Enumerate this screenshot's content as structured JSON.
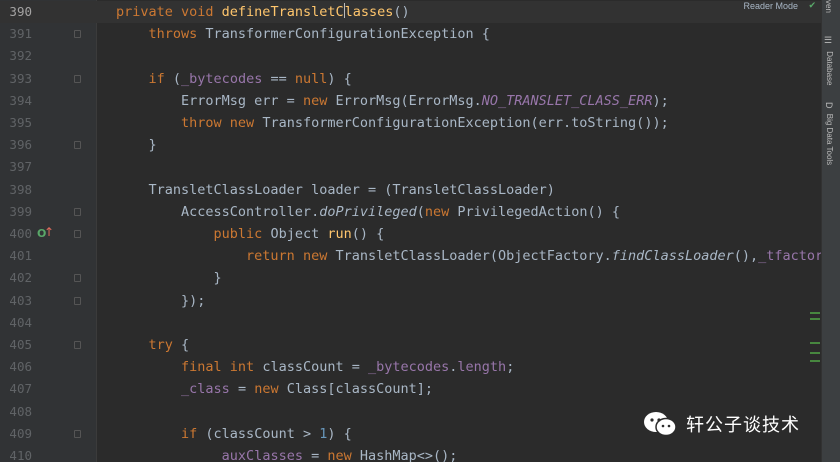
{
  "editor": {
    "reader_mode_label": "Reader Mode",
    "lines": [
      {
        "n": "390",
        "current": true,
        "tokens": [
          [
            "kw",
            "private "
          ],
          [
            "kw",
            "void "
          ],
          [
            "fn",
            "defineTransletC"
          ],
          [
            "caret",
            ""
          ],
          [
            "fn",
            "lasses"
          ],
          [
            "p",
            "()"
          ]
        ]
      },
      {
        "n": "391",
        "fold": true,
        "tokens": [
          [
            "p",
            "    "
          ],
          [
            "kw",
            "throws "
          ],
          [
            "p",
            "TransformerConfigurationException {"
          ]
        ]
      },
      {
        "n": "392",
        "tokens": []
      },
      {
        "n": "393",
        "fold": true,
        "tokens": [
          [
            "p",
            "    "
          ],
          [
            "kw",
            "if "
          ],
          [
            "p",
            "("
          ],
          [
            "fld",
            "_bytecodes"
          ],
          [
            "p",
            " == "
          ],
          [
            "kw",
            "null"
          ],
          [
            "p",
            ") {"
          ]
        ]
      },
      {
        "n": "394",
        "tokens": [
          [
            "p",
            "        ErrorMsg err = "
          ],
          [
            "kw",
            "new "
          ],
          [
            "p",
            "ErrorMsg(ErrorMsg."
          ],
          [
            "sfld",
            "NO_TRANSLET_CLASS_ERR"
          ],
          [
            "p",
            ");"
          ]
        ]
      },
      {
        "n": "395",
        "tokens": [
          [
            "p",
            "        "
          ],
          [
            "kw",
            "throw new "
          ],
          [
            "p",
            "TransformerConfigurationException(err.toString());"
          ]
        ]
      },
      {
        "n": "396",
        "fold": true,
        "tokens": [
          [
            "p",
            "    }"
          ]
        ]
      },
      {
        "n": "397",
        "tokens": []
      },
      {
        "n": "398",
        "tokens": [
          [
            "p",
            "    TransletClassLoader loader = (TransletClassLoader)"
          ]
        ]
      },
      {
        "n": "399",
        "fold": true,
        "tokens": [
          [
            "p",
            "        AccessController."
          ],
          [
            "smeth",
            "doPrivileged"
          ],
          [
            "p",
            "("
          ],
          [
            "kw",
            "new "
          ],
          [
            "p",
            "PrivilegedAction() {"
          ]
        ]
      },
      {
        "n": "400",
        "fold": true,
        "tokens": [
          [
            "p",
            "            "
          ],
          [
            "kw",
            "public "
          ],
          [
            "p",
            "Object "
          ],
          [
            "fn",
            "run"
          ],
          [
            "p",
            "() {"
          ]
        ]
      },
      {
        "n": "401",
        "tokens": [
          [
            "p",
            "                "
          ],
          [
            "kw",
            "return new "
          ],
          [
            "p",
            "TransletClassLoader(ObjectFactory."
          ],
          [
            "smeth",
            "findClassLoader"
          ],
          [
            "p",
            "(),"
          ],
          [
            "fld",
            "_tfactory"
          ],
          [
            "p",
            ".ge"
          ]
        ]
      },
      {
        "n": "402",
        "fold": true,
        "tokens": [
          [
            "p",
            "            }"
          ]
        ]
      },
      {
        "n": "403",
        "fold": true,
        "tokens": [
          [
            "p",
            "        });"
          ]
        ]
      },
      {
        "n": "404",
        "tokens": []
      },
      {
        "n": "405",
        "fold": true,
        "tokens": [
          [
            "p",
            "    "
          ],
          [
            "kw",
            "try "
          ],
          [
            "p",
            "{"
          ]
        ]
      },
      {
        "n": "406",
        "tokens": [
          [
            "p",
            "        "
          ],
          [
            "kw",
            "final int "
          ],
          [
            "p",
            "classCount = "
          ],
          [
            "fld",
            "_bytecodes"
          ],
          [
            "p",
            "."
          ],
          [
            "fld",
            "length"
          ],
          [
            "p",
            ";"
          ]
        ]
      },
      {
        "n": "407",
        "tokens": [
          [
            "p",
            "        "
          ],
          [
            "fld",
            "_class"
          ],
          [
            "p",
            " = "
          ],
          [
            "kw",
            "new "
          ],
          [
            "p",
            "Class[classCount];"
          ]
        ]
      },
      {
        "n": "408",
        "tokens": []
      },
      {
        "n": "409",
        "fold": true,
        "tokens": [
          [
            "p",
            "        "
          ],
          [
            "kw",
            "if "
          ],
          [
            "p",
            "(classCount > "
          ],
          [
            "num",
            "1"
          ],
          [
            "p",
            ") {"
          ]
        ]
      },
      {
        "n": "410",
        "tokens": [
          [
            "p",
            "            "
          ],
          [
            "fld",
            "_auxClasses"
          ],
          [
            "p",
            " = "
          ],
          [
            "kw",
            "new "
          ],
          [
            "p",
            "HashMap<>();"
          ]
        ]
      }
    ]
  },
  "right_panel": {
    "tabs": [
      {
        "label": "Database",
        "icon": "database-icon"
      },
      {
        "label": "Big Data Tools",
        "icon": "big-data-tools-icon"
      }
    ],
    "top_label": "ven"
  },
  "watermark": {
    "text": "轩公子谈技术"
  },
  "colors": {
    "background": "#2b2b2b",
    "keyword": "#cc7832",
    "method_decl": "#ffc66d",
    "field": "#9876aa",
    "number": "#6897bb",
    "default_text": "#a9b7c6"
  }
}
